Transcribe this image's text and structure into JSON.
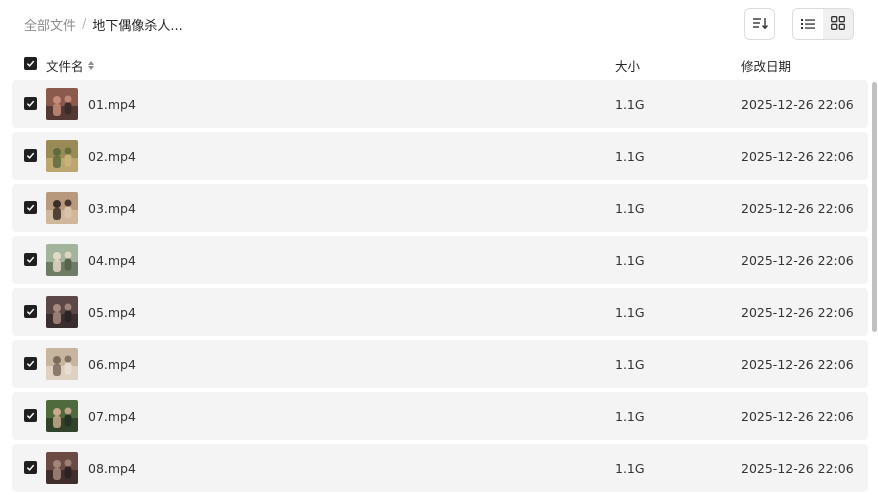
{
  "breadcrumb": {
    "root": "全部文件",
    "separator": "/",
    "current": "地下偶像杀人..."
  },
  "toolbar": {
    "sort_icon": "sort-descending-icon",
    "view_list_icon": "list-view-icon",
    "view_grid_icon": "grid-view-icon",
    "active_view": "list"
  },
  "columns": {
    "name": "文件名",
    "size": "大小",
    "modified": "修改日期"
  },
  "colors": {
    "checkbox": "#1f1f1f",
    "row_bg": "#f4f4f4",
    "scroll_thumb": "#c1c1c1"
  },
  "files": [
    {
      "name": "01.mp4",
      "size": "1.1G",
      "modified": "2025-12-26 22:06",
      "checked": true,
      "thumb_colors": [
        "#8a5a4c",
        "#c48c7a",
        "#3d2a2a"
      ]
    },
    {
      "name": "02.mp4",
      "size": "1.1G",
      "modified": "2025-12-26 22:06",
      "checked": true,
      "thumb_colors": [
        "#9a8a55",
        "#5f6b3c",
        "#c9b27a"
      ]
    },
    {
      "name": "03.mp4",
      "size": "1.1G",
      "modified": "2025-12-26 22:06",
      "checked": true,
      "thumb_colors": [
        "#b79a7e",
        "#3b2d28",
        "#d9c3a8"
      ]
    },
    {
      "name": "04.mp4",
      "size": "1.1G",
      "modified": "2025-12-26 22:06",
      "checked": true,
      "thumb_colors": [
        "#a3b49d",
        "#e2d8c4",
        "#59644d"
      ]
    },
    {
      "name": "05.mp4",
      "size": "1.1G",
      "modified": "2025-12-26 22:06",
      "checked": true,
      "thumb_colors": [
        "#5a4746",
        "#a78980",
        "#2c2325"
      ]
    },
    {
      "name": "06.mp4",
      "size": "1.1G",
      "modified": "2025-12-26 22:06",
      "checked": true,
      "thumb_colors": [
        "#c8b5a0",
        "#7b6b5c",
        "#e7ddd0"
      ]
    },
    {
      "name": "07.mp4",
      "size": "1.1G",
      "modified": "2025-12-26 22:06",
      "checked": true,
      "thumb_colors": [
        "#4f6a3c",
        "#c7a98c",
        "#263322"
      ]
    },
    {
      "name": "08.mp4",
      "size": "1.1G",
      "modified": "2025-12-26 22:06",
      "checked": true,
      "thumb_colors": [
        "#6b4a44",
        "#a1877a",
        "#2e2222"
      ]
    }
  ]
}
